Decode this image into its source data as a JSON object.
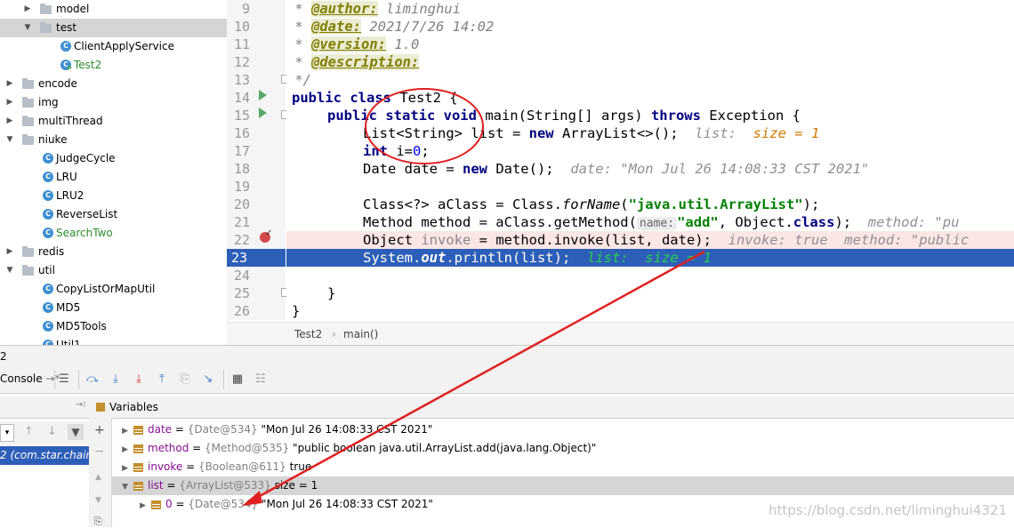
{
  "tree": [
    {
      "label": "model",
      "type": "folder",
      "indent": 0,
      "arrow": "▶"
    },
    {
      "label": "test",
      "type": "folder",
      "indent": 0,
      "arrow": "▼",
      "selected": true
    },
    {
      "label": "ClientApplyService",
      "type": "class",
      "indent": 2
    },
    {
      "label": "Test2",
      "type": "class-run",
      "indent": 2,
      "color": "#2c8c2c"
    },
    {
      "label": "encode",
      "type": "folder",
      "indent": -1,
      "arrow": "▶"
    },
    {
      "label": "img",
      "type": "folder",
      "indent": -1,
      "arrow": "▶"
    },
    {
      "label": "multiThread",
      "type": "folder",
      "indent": -1,
      "arrow": "▶"
    },
    {
      "label": "niuke",
      "type": "folder",
      "indent": -1,
      "arrow": "▼"
    },
    {
      "label": "JudgeCycle",
      "type": "class",
      "indent": 1
    },
    {
      "label": "LRU",
      "type": "class",
      "indent": 1
    },
    {
      "label": "LRU2",
      "type": "class",
      "indent": 1
    },
    {
      "label": "ReverseList",
      "type": "class",
      "indent": 1
    },
    {
      "label": "SearchTwo",
      "type": "class",
      "indent": 1,
      "color": "#2c8c2c"
    },
    {
      "label": "redis",
      "type": "folder",
      "indent": -1,
      "arrow": "▶"
    },
    {
      "label": "util",
      "type": "folder",
      "indent": -1,
      "arrow": "▼"
    },
    {
      "label": "CopyListOrMapUtil",
      "type": "class",
      "indent": 1
    },
    {
      "label": "MD5",
      "type": "class",
      "indent": 1
    },
    {
      "label": "MD5Tools",
      "type": "class",
      "indent": 1
    },
    {
      "label": "Util1",
      "type": "class",
      "indent": 1
    }
  ],
  "line_numbers": [
    "9",
    "10",
    "11",
    "12",
    "13",
    "14",
    "15",
    "16",
    "17",
    "18",
    "19",
    "20",
    "21",
    "22",
    "23",
    "24",
    "25",
    "26"
  ],
  "code": {
    "l9": [
      "<span class='cm'> * </span><span class='tag'>@author:</span><span class='cm'> liminghui</span>"
    ],
    "l10": [
      "<span class='cm'> * </span><span class='tag'>@date:</span><span class='cm'> 2021/7/26 14:02</span>"
    ],
    "l11": [
      "<span class='cm'> * </span><span class='tag'>@version:</span><span class='cm'> 1.0</span>"
    ],
    "l12": [
      "<span class='cm'> * </span><span class='tag'>@description:</span>"
    ],
    "l13": [
      "<span class='cm'> */</span>"
    ]
  },
  "code_text": {
    "c9a": " * ",
    "c9b": "@author:",
    "c9c": " liminghui",
    "c10a": " * ",
    "c10b": "@date:",
    "c10c": " 2021/7/26 14:02",
    "c11a": " * ",
    "c11b": "@version:",
    "c11c": " 1.0",
    "c12a": " * ",
    "c12b": "@description:",
    "c13": " */",
    "c14k": "public class",
    "c14": " Test2 {",
    "c15k": "public static void",
    "c15a": " main(String[] args) ",
    "c15k2": "throws",
    "c15b": " Exception {",
    "c16a": "List<String> list = ",
    "c16k": "new",
    "c16b": " ArrayList<>();",
    "c16d": "list:",
    "c16v": "size = 1",
    "c17k": "int",
    "c17a": " i=",
    "c17n": "0",
    "c17b": ";",
    "c18a": "Date date = ",
    "c18k": "new",
    "c18b": " Date();",
    "c18d": "date: \"Mon Jul 26 14:08:33 CST 2021\"",
    "c20a": "Class<?> aClass = Class.",
    "c20i": "forName",
    "c20b": "(",
    "c20s": "\"java.util.ArrayList\"",
    "c20c": ");",
    "c21a": "Method method = aClass.getMethod(",
    "c21h": "name:",
    "c21s": "\"add\"",
    "c21b": ", Object.",
    "c21k": "class",
    "c21c": ");",
    "c21d": "method: \"pu",
    "c22a": "Object ",
    "c22v": "invoke",
    "c22b": " = method.invoke(list, date);",
    "c22d": "invoke: true  method: \"public",
    "c23a": "System.",
    "c23o": "out",
    "c23b": ".println(list);",
    "c23d": "list:  size = 1",
    "c25": "}",
    "c26": "}"
  },
  "breadcrumb": {
    "class": "Test2",
    "method": "main()"
  },
  "debug": {
    "tab_num": "2",
    "console_label": "Console",
    "variables_title": "Variables",
    "frame_label": "2 (com.star.chain.",
    "vars": [
      {
        "name": "date",
        "type": "{Date@534}",
        "value": "\"Mon Jul 26 14:08:33 CST 2021\"",
        "arrow": "▶"
      },
      {
        "name": "method",
        "type": "{Method@535}",
        "value": "\"public boolean java.util.ArrayList.add(java.lang.Object)\"",
        "arrow": "▶"
      },
      {
        "name": "invoke",
        "type": "{Boolean@611}",
        "value": "true",
        "arrow": "▶"
      },
      {
        "name": "list",
        "type": "{ArrayList@533}",
        "value": "size = 1",
        "arrow": "▼",
        "selected": true
      },
      {
        "name": "0",
        "type": "{Date@534}",
        "value": "\"Mon Jul 26 14:08:33 CST 2021\"",
        "arrow": "▶",
        "child": true
      }
    ]
  },
  "watermark": "https://blog.csdn.net/liminghui4321",
  "colors": {
    "annotation_red": "#e02020",
    "current_line": "#2e5fb8",
    "breakpoint_line": "#fae6e4"
  }
}
